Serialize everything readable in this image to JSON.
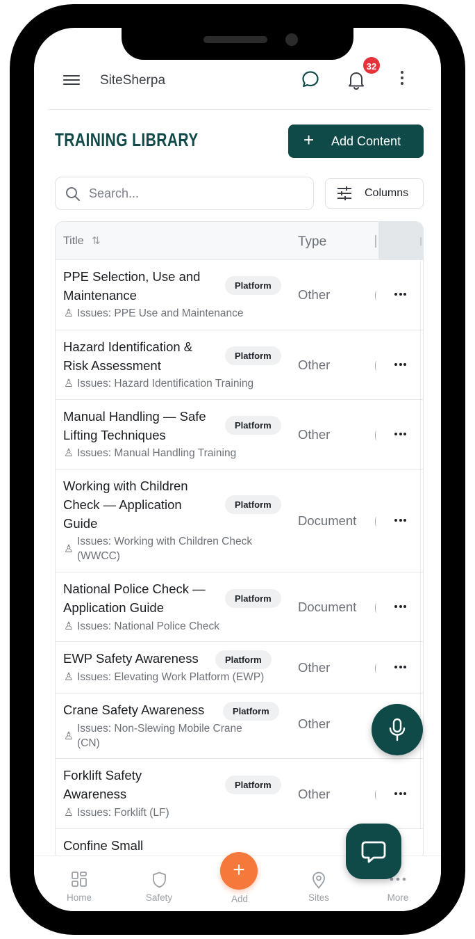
{
  "app": {
    "brand": "SiteSherpa",
    "notification_count": "32"
  },
  "header": {
    "title": "TRAINING LIBRARY",
    "add_content_label": "Add Content"
  },
  "search": {
    "placeholder": "Search...",
    "value": ""
  },
  "toolbar": {
    "columns_label": "Columns"
  },
  "table": {
    "columns": [
      "Title",
      "Type"
    ],
    "rows": [
      {
        "title": "PPE Selection, Use and Maintenance",
        "title_lines": [
          "PPE Selection, Use and",
          "Maintenance"
        ],
        "badge": "Platform",
        "issues": "Issues: PPE Use and Maintenance",
        "type": "Other"
      },
      {
        "title": "Hazard Identification & Risk Assessment",
        "title_lines": [
          "Hazard Identification &",
          "Risk Assessment"
        ],
        "badge": "Platform",
        "issues": "Issues: Hazard Identification Training",
        "type": "Other"
      },
      {
        "title": "Manual Handling — Safe Lifting Techniques",
        "title_lines": [
          "Manual Handling — Safe",
          "Lifting Techniques"
        ],
        "badge": "Platform",
        "issues": "Issues: Manual Handling Training",
        "type": "Other"
      },
      {
        "title": "Working with Children Check — Application Guide",
        "title_lines": [
          "Working with Children",
          "Check — Application",
          "Guide"
        ],
        "badge": "Platform",
        "issues": "Issues: Working with Children Check (WWCC)",
        "issues_lines": [
          "Issues: Working with Children Check",
          "(WWCC)"
        ],
        "type": "Document"
      },
      {
        "title": "National Police Check — Application Guide",
        "title_lines": [
          "National Police Check —",
          "Application Guide"
        ],
        "badge": "Platform",
        "issues": "Issues: National Police Check",
        "type": "Document"
      },
      {
        "title": "EWP Safety Awareness",
        "title_lines": [
          "EWP Safety Awareness"
        ],
        "badge": "Platform",
        "issues": "Issues: Elevating Work Platform (EWP)",
        "type": "Other"
      },
      {
        "title": "Crane Safety Awareness",
        "title_lines": [
          "Crane Safety Awareness"
        ],
        "badge": "Platform",
        "issues": "Issues: Non-Slewing Mobile Crane (CN)",
        "issues_lines": [
          "Issues: Non-Slewing Mobile Crane",
          "(CN)"
        ],
        "type": "Other"
      },
      {
        "title": "Forklift Safety Awareness",
        "title_lines": [
          "Forklift Safety",
          "Awareness"
        ],
        "badge": "Platform",
        "issues": "Issues: Forklift (LF)",
        "type": "Other"
      },
      {
        "title": "Confine Small",
        "title_lines": [
          "Confine Small"
        ]
      }
    ]
  },
  "bottom_nav": {
    "home": "Home",
    "safety": "Safety",
    "add": "Add",
    "sites": "Sites",
    "more": "More"
  },
  "colors": {
    "brand_dark": "#0f4a48",
    "accent_orange": "#f5793b",
    "badge_red": "#e5323b"
  },
  "icons": [
    "menu-icon",
    "chat-icon",
    "bell-icon",
    "more-vertical-icon",
    "plus-icon",
    "search-icon",
    "sliders-icon",
    "sort-icon",
    "award-icon",
    "more-horizontal-icon",
    "mic-icon",
    "support-chat-icon",
    "home-grid-icon",
    "shield-icon",
    "map-pin-icon"
  ]
}
